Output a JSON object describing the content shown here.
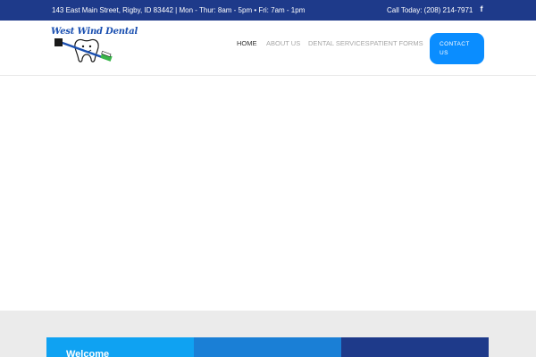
{
  "topbar": {
    "address": "143 East Main Street, Rigby, ID 83442 | Mon - Thur: 8am - 5pm • Fri: 7am - 1pm",
    "phone": "Call Today: (208) 214-7971",
    "facebook_glyph": "f",
    "background": "#1e3a8a"
  },
  "logo": {
    "text": "West Wind Dental",
    "icon": "tooth-with-toothbrush-logo"
  },
  "nav": {
    "items": [
      {
        "label": "HOME",
        "active": true
      },
      {
        "label": "ABOUT US",
        "active": false
      },
      {
        "label": "DENTAL SERVICES",
        "active": false
      },
      {
        "label": "PATIENT FORMS",
        "active": false
      }
    ],
    "cta_line1": "CONTACT",
    "cta_line2": "US",
    "cta_color": "#0a8dff"
  },
  "cards": {
    "first_title": "Welcome",
    "colors": [
      "#0fa2f2",
      "#1a7fd6",
      "#1e3a8a"
    ]
  }
}
